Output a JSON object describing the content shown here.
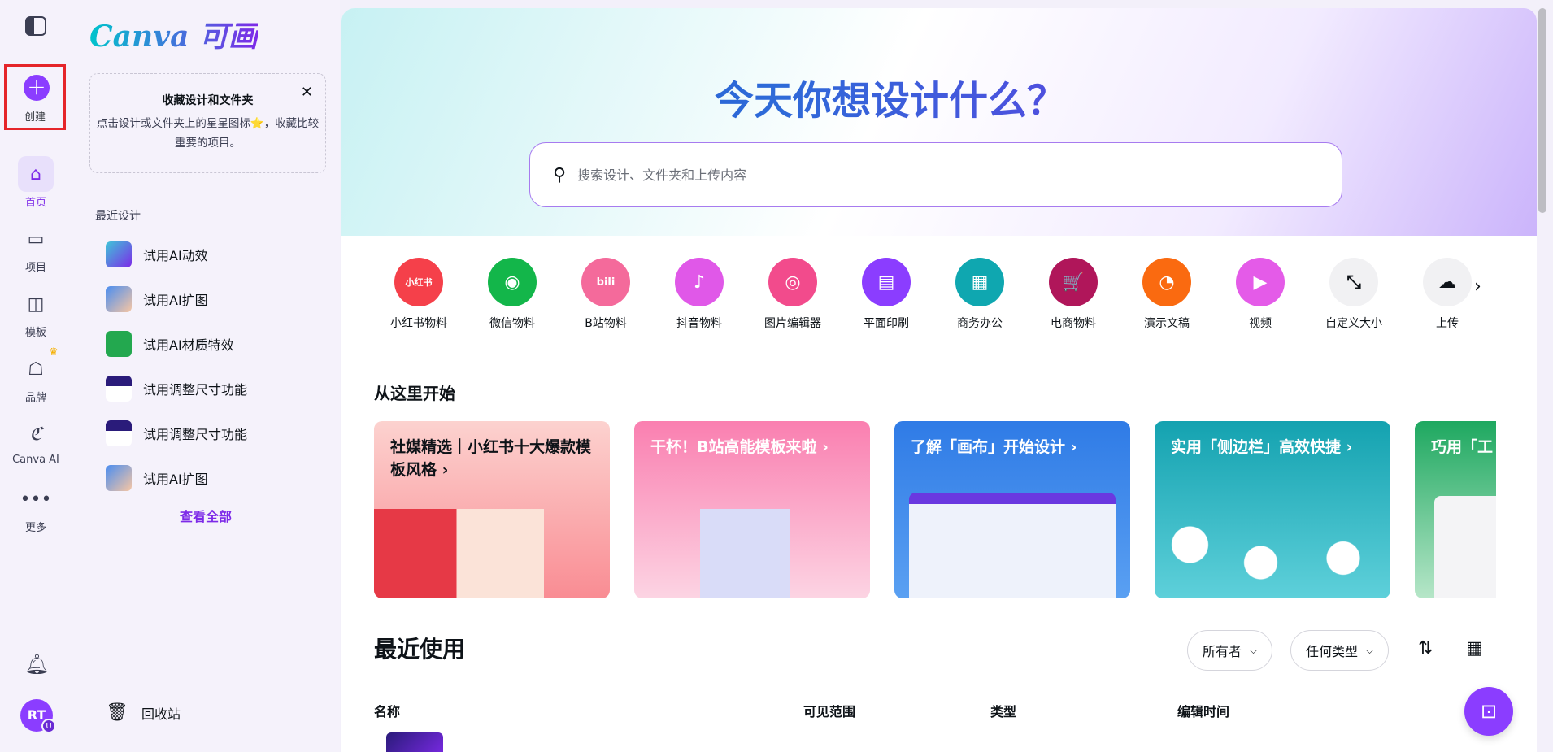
{
  "rail": {
    "create_label": "创建",
    "items": [
      {
        "label": "首页",
        "icon": "home-icon"
      },
      {
        "label": "项目",
        "icon": "folder-icon"
      },
      {
        "label": "模板",
        "icon": "template-icon"
      },
      {
        "label": "品牌",
        "icon": "brand-icon"
      },
      {
        "label": "Canva AI",
        "icon": "canva-ai-icon"
      },
      {
        "label": "更多",
        "icon": "more-icon"
      }
    ],
    "avatar_initials": "RT",
    "avatar_badge": "U"
  },
  "panel": {
    "logo": "Canva 可画",
    "favorites": {
      "title": "收藏设计和文件夹",
      "desc": "点击设计或文件夹上的星星图标⭐，收藏比较重要的项目。"
    },
    "recent_label": "最近设计",
    "recent_items": [
      {
        "label": "试用AI动效"
      },
      {
        "label": "试用AI扩图"
      },
      {
        "label": "试用AI材质特效"
      },
      {
        "label": "试用调整尺寸功能"
      },
      {
        "label": "试用调整尺寸功能"
      },
      {
        "label": "试用AI扩图"
      }
    ],
    "view_all": "查看全部",
    "trash": "回收站"
  },
  "main": {
    "hero_title": "今天你想设计什么？",
    "search_placeholder": "搜索设计、文件夹和上传内容",
    "categories": [
      {
        "label": "小红书物料",
        "color": "#f5404a",
        "glyph": "小红书"
      },
      {
        "label": "微信物料",
        "color": "#13b64a",
        "glyph": "◉"
      },
      {
        "label": "B站物料",
        "color": "#f46a9b",
        "glyph": "bili"
      },
      {
        "label": "抖音物料",
        "color": "#e058e8",
        "glyph": "♪"
      },
      {
        "label": "图片编辑器",
        "color": "#f24b8c",
        "glyph": "◎"
      },
      {
        "label": "平面印刷",
        "color": "#8b3dff",
        "glyph": "▤"
      },
      {
        "label": "商务办公",
        "color": "#0fa7b0",
        "glyph": "▦"
      },
      {
        "label": "电商物料",
        "color": "#b0165a",
        "glyph": "🛒"
      },
      {
        "label": "演示文稿",
        "color": "#fa6a10",
        "glyph": "◔"
      },
      {
        "label": "视频",
        "color": "#e45be8",
        "glyph": "▶"
      },
      {
        "label": "自定义大小",
        "color": "#f1f1f3",
        "glyph": "⤡"
      },
      {
        "label": "上传",
        "color": "#f1f1f3",
        "glyph": "☁"
      }
    ],
    "start_heading": "从这里开始",
    "cards": [
      {
        "title": "社媒精选｜小红书十大爆款模板风格 ›",
        "bg": "#fbb8b8"
      },
      {
        "title": "干杯！B站高能模板来啦 ›",
        "bg": "#f9a0c0"
      },
      {
        "title": "了解「画布」开始设计 ›",
        "bg": "#2f7be6"
      },
      {
        "title": "实用「侧边栏」高效快捷 ›",
        "bg": "#18a3b0"
      },
      {
        "title": "巧用「工",
        "bg": "#27b46d"
      }
    ],
    "recent_heading": "最近使用",
    "filters": {
      "owner": "所有者",
      "type": "任何类型"
    },
    "table_headers": {
      "name": "名称",
      "visibility": "可见范围",
      "type": "类型",
      "edited": "编辑时间"
    }
  }
}
